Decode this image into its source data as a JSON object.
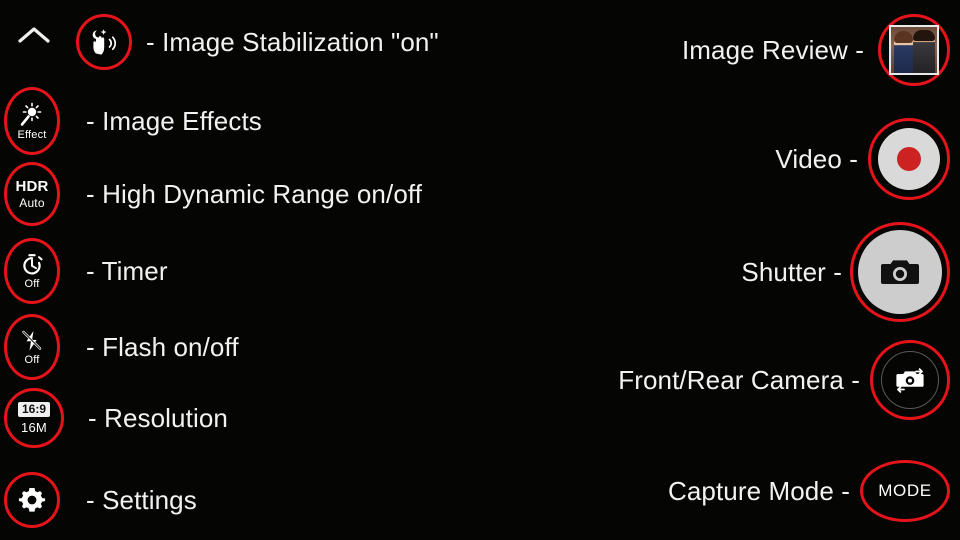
{
  "screen": {
    "background_color": "#050504",
    "accent_ring_color": "#e6131a",
    "text_color": "#f2f2f2",
    "title": "Camera Controls Annotated Overlay"
  },
  "top_bar": {
    "collapse_icon": "chevron-up-icon"
  },
  "left_column": [
    {
      "icon_name": "image-stabilization-icon",
      "icon_main": "",
      "icon_sub": "",
      "label": "- Image Stabilization \"on\"",
      "ring_shape": "circle"
    },
    {
      "icon_name": "image-effects-icon",
      "icon_main": "",
      "icon_sub": "Effect",
      "label": "- Image Effects",
      "ring_shape": "ellipse"
    },
    {
      "icon_name": "hdr-icon",
      "icon_main": "HDR",
      "icon_sub": "Auto",
      "label": "- High Dynamic Range on/off",
      "ring_shape": "ellipse"
    },
    {
      "icon_name": "timer-icon",
      "icon_main": "",
      "icon_sub": "Off",
      "label": "- Timer",
      "ring_shape": "ellipse"
    },
    {
      "icon_name": "flash-off-icon",
      "icon_main": "",
      "icon_sub": "Off",
      "label": "- Flash on/off",
      "ring_shape": "ellipse"
    },
    {
      "icon_name": "resolution-icon",
      "icon_main": "16:9",
      "icon_sub": "16M",
      "label": "- Resolution",
      "ring_shape": "circle"
    },
    {
      "icon_name": "settings-gear-icon",
      "icon_main": "",
      "icon_sub": "",
      "label": "- Settings",
      "ring_shape": "circle"
    }
  ],
  "right_column": [
    {
      "label": "Image Review -",
      "control_name": "image-review-thumbnail",
      "control_text": ""
    },
    {
      "label": "Video -",
      "control_name": "video-record-button",
      "control_text": ""
    },
    {
      "label": "Shutter -",
      "control_name": "shutter-button",
      "control_text": ""
    },
    {
      "label": "Front/Rear Camera -",
      "control_name": "camera-flip-button",
      "control_text": ""
    },
    {
      "label": "Capture Mode -",
      "control_name": "capture-mode-button",
      "control_text": "MODE"
    }
  ]
}
